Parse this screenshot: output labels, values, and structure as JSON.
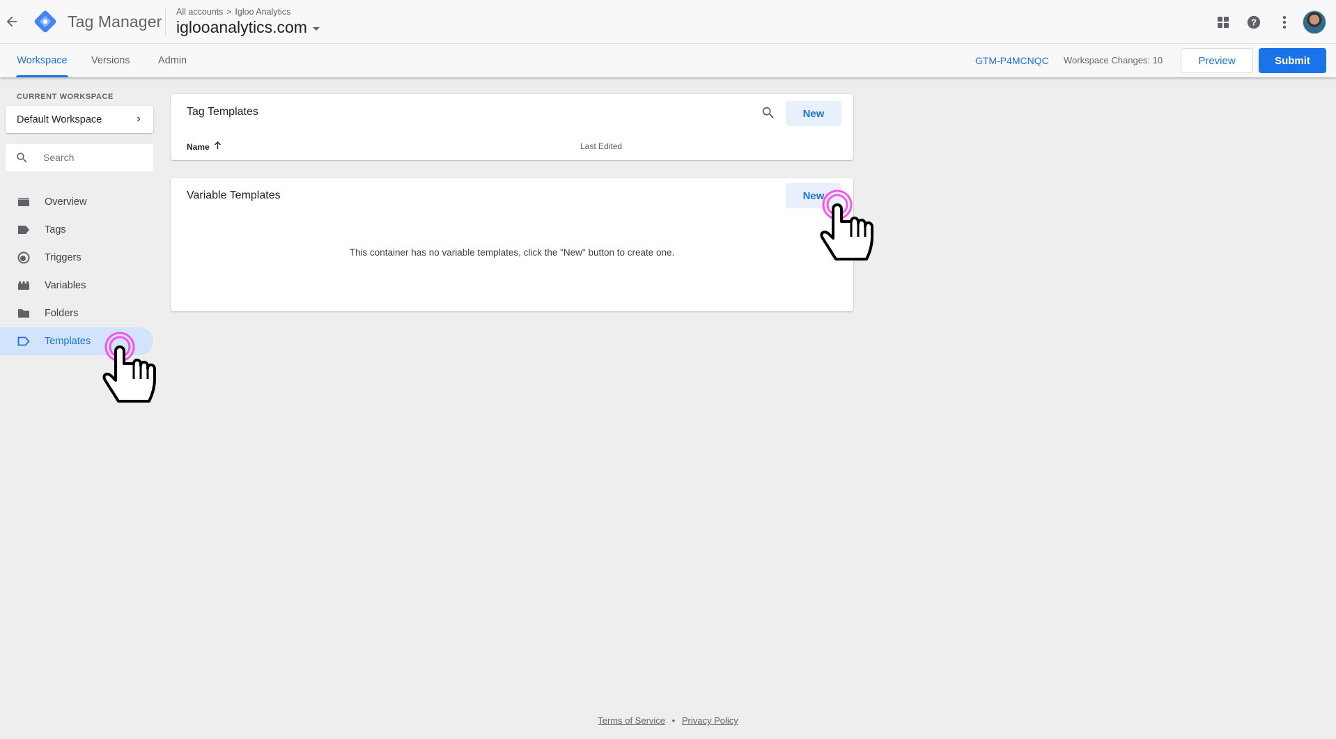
{
  "header": {
    "app_title": "Tag Manager",
    "breadcrumb": {
      "root": "All accounts",
      "separator": ">",
      "account": "Igloo Analytics"
    },
    "container_name": "iglooanalytics.com"
  },
  "subnav": {
    "tabs": [
      {
        "label": "Workspace",
        "active": true
      },
      {
        "label": "Versions",
        "active": false
      },
      {
        "label": "Admin",
        "active": false
      }
    ],
    "container_id": "GTM-P4MCNQC",
    "workspace_changes": "Workspace Changes: 10",
    "preview_label": "Preview",
    "submit_label": "Submit"
  },
  "sidebar": {
    "current_workspace_label": "CURRENT WORKSPACE",
    "workspace_name": "Default Workspace",
    "search_placeholder": "Search",
    "items": [
      {
        "label": "Overview",
        "icon": "overview-icon",
        "active": false
      },
      {
        "label": "Tags",
        "icon": "tag-icon",
        "active": false
      },
      {
        "label": "Triggers",
        "icon": "trigger-icon",
        "active": false
      },
      {
        "label": "Variables",
        "icon": "variables-icon",
        "active": false
      },
      {
        "label": "Folders",
        "icon": "folder-icon",
        "active": false
      },
      {
        "label": "Templates",
        "icon": "template-icon",
        "active": true
      }
    ]
  },
  "tag_templates": {
    "title": "Tag Templates",
    "new_label": "New",
    "columns": {
      "name": "Name",
      "last_edited": "Last Edited"
    }
  },
  "variable_templates": {
    "title": "Variable Templates",
    "new_label": "New",
    "empty_message": "This container has no variable templates, click the \"New\" button to create one."
  },
  "footer": {
    "terms": "Terms of Service",
    "separator": "•",
    "privacy": "Privacy Policy"
  },
  "colors": {
    "accent": "#1a73e8",
    "active_nav_bg": "#d2e3fc",
    "new_button_bg": "#e8f0fe",
    "cursor_ring": "#ff36e6"
  }
}
